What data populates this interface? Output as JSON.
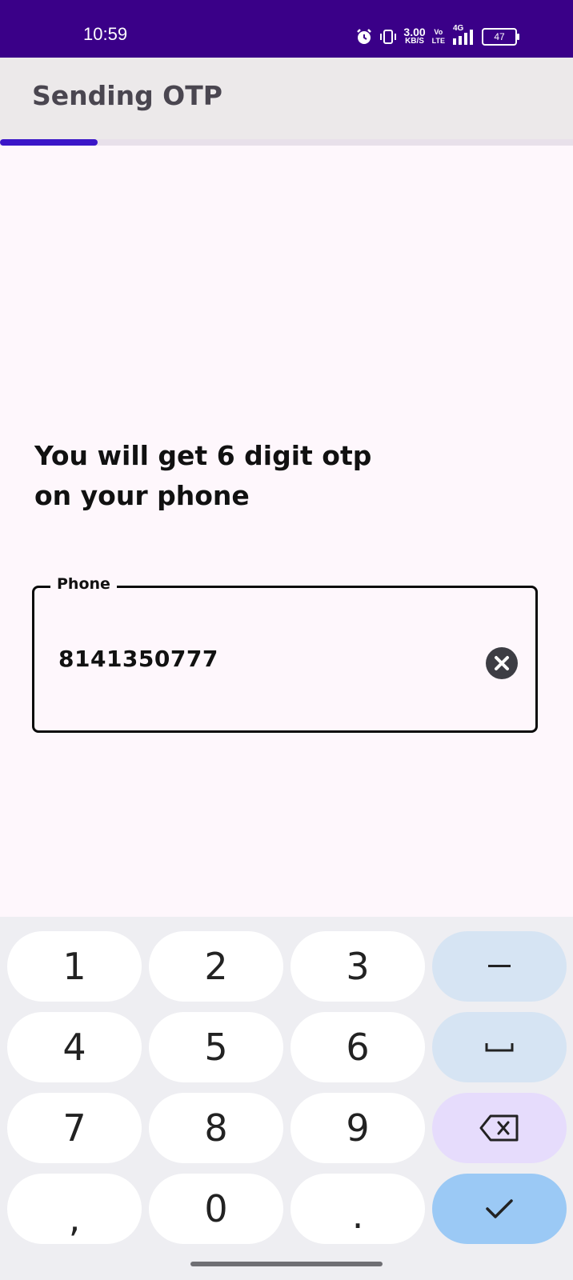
{
  "status_bar": {
    "time": "10:59",
    "net_speed_value": "3.00",
    "net_speed_unit": "KB/S",
    "volte_top": "Vo",
    "volte_bottom": "LTE",
    "network_type": "4G",
    "battery_level": "47",
    "background_color": "#3a0088"
  },
  "app_bar": {
    "title": "Sending OTP",
    "progress_fraction": 0.17,
    "progress_color": "#3b16c8"
  },
  "main": {
    "headline_line1": "You will get 6 digit otp",
    "headline_line2": "on your phone",
    "phone_field": {
      "label": "Phone",
      "value": "8141350777"
    }
  },
  "keyboard": {
    "keys": [
      {
        "label": "1",
        "icon": null
      },
      {
        "label": "2",
        "icon": null
      },
      {
        "label": "3",
        "icon": null
      },
      {
        "label": "",
        "icon": "minus-icon"
      },
      {
        "label": "4",
        "icon": null
      },
      {
        "label": "5",
        "icon": null
      },
      {
        "label": "6",
        "icon": null
      },
      {
        "label": "",
        "icon": "space-icon"
      },
      {
        "label": "7",
        "icon": null
      },
      {
        "label": "8",
        "icon": null
      },
      {
        "label": "9",
        "icon": null
      },
      {
        "label": "",
        "icon": "backspace-icon"
      },
      {
        "label": ",",
        "icon": null
      },
      {
        "label": "0",
        "icon": null
      },
      {
        "label": ".",
        "icon": null
      },
      {
        "label": "",
        "icon": "check-icon"
      }
    ]
  }
}
